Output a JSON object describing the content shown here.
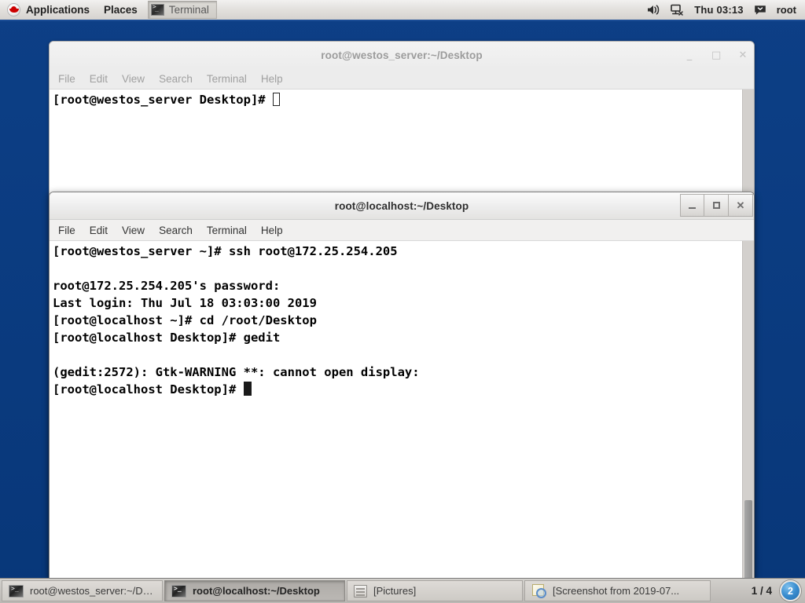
{
  "top_panel": {
    "logo_icon": "redhat-logo-icon",
    "applications_label": "Applications",
    "places_label": "Places",
    "window_list": [
      {
        "icon": "terminal-icon",
        "label": "Terminal"
      }
    ],
    "right": {
      "volume_icon": "volume-icon",
      "network_icon": "network-disconnected-icon",
      "clock": "Thu 03:13",
      "messages_icon": "messages-icon",
      "user": "root"
    }
  },
  "windows": [
    {
      "id": "background",
      "title": "root@westos_server:~/Desktop",
      "active": false,
      "menus": [
        "File",
        "Edit",
        "View",
        "Search",
        "Terminal",
        "Help"
      ],
      "buttons": {
        "minimize": "_",
        "maximize": "□",
        "close": "✕"
      },
      "terminal_lines": [
        "[root@westos_server Desktop]# "
      ],
      "cursor": "hollow"
    },
    {
      "id": "active",
      "title": "root@localhost:~/Desktop",
      "active": true,
      "menus": [
        "File",
        "Edit",
        "View",
        "Search",
        "Terminal",
        "Help"
      ],
      "buttons": {
        "minimize": "_",
        "maximize": "□",
        "close": "✕"
      },
      "terminal_lines": [
        "[root@westos_server ~]# ssh root@172.25.254.205",
        "",
        "root@172.25.254.205's password:",
        "Last login: Thu Jul 18 03:03:00 2019",
        "[root@localhost ~]# cd /root/Desktop",
        "[root@localhost Desktop]# gedit",
        "",
        "(gedit:2572): Gtk-WARNING **: cannot open display:",
        "[root@localhost Desktop]# "
      ],
      "cursor": "block"
    }
  ],
  "taskbar": {
    "items": [
      {
        "icon": "terminal-icon",
        "label": "root@westos_server:~/Des...",
        "active": false
      },
      {
        "icon": "terminal-icon",
        "label": "root@localhost:~/Desktop",
        "active": true
      },
      {
        "icon": "folder-icon",
        "label": "[Pictures]",
        "active": false
      },
      {
        "icon": "screenshot-icon",
        "label": "[Screenshot from 2019-07...",
        "active": false
      }
    ],
    "workspace": "1 / 4",
    "notification_count": "2"
  },
  "colors": {
    "desktop": "#0c3d82",
    "panel": "#e3e1de",
    "taskbar": "#c6c3bf",
    "terminal_bg": "#ffffff",
    "terminal_fg": "#000000",
    "accent_blue": "#3b8ed0"
  }
}
